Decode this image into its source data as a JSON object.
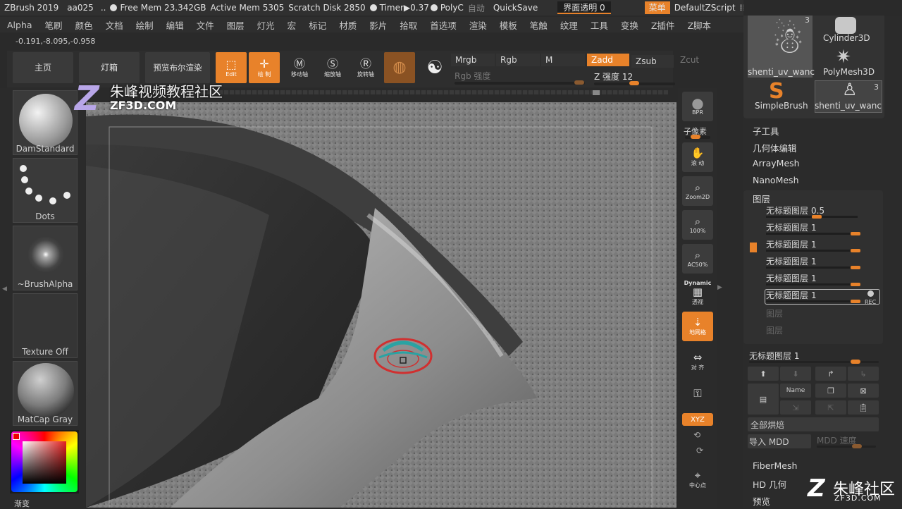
{
  "titlebar": {
    "app": "ZBrush 2019",
    "doc": "aa025",
    "free_mem": "Free Mem 23.342GB",
    "active_mem": "Active Mem 5305",
    "scratch": "Scratch Disk 2850",
    "timer": "Timer▶0.37",
    "polycount": "PolyC",
    "auto": "自动",
    "quicksave": "QuickSave",
    "transparency": "界面透明 0",
    "menu": "菜单",
    "script": "DefaultZScript"
  },
  "menubar": [
    "Alpha",
    "笔刷",
    "颜色",
    "文档",
    "绘制",
    "编辑",
    "文件",
    "图层",
    "灯光",
    "宏",
    "标记",
    "材质",
    "影片",
    "拾取",
    "首选项",
    "渲染",
    "模板",
    "笔触",
    "纹理",
    "工具",
    "变换",
    "Z插件",
    "Z脚本"
  ],
  "coords": "-0.191,-8.095,-0.958",
  "toolbar": {
    "home": "主页",
    "lightbox": "灯箱",
    "bpr_preview": "预览布尔渲染",
    "edit": "Edit",
    "draw": "绘 制",
    "move": "移动轴",
    "scale": "缩放轴",
    "rotate": "旋转轴",
    "mrgb": "Mrgb",
    "rgb": "Rgb",
    "m": "M",
    "zadd": "Zadd",
    "zsub": "Zsub",
    "zcut": "Zcut",
    "rgb_intensity": "Rgb 强度",
    "z_intensity": "Z 强度 12"
  },
  "watermark": {
    "title": "朱峰视频教程社区",
    "url": "ZF3D.COM",
    "brand": "朱峰社区",
    "brand_url": "ZF3D.COM"
  },
  "left_tray": {
    "brush": "DamStandard",
    "stroke": "Dots",
    "alpha": "~BrushAlpha",
    "texture": "Texture Off",
    "material": "MatCap Gray",
    "gradient": "渐变"
  },
  "right_shelf": {
    "bpr": "BPR",
    "subpixel": "子像素",
    "scroll": "滚 动",
    "zoom2d": "Zoom2D",
    "pct100": "100%",
    "ac50": "AC50%",
    "dynamic": "Dynamic",
    "persp": "透视",
    "floor": "地网格",
    "frame": "对 齐",
    "lock": "",
    "xyz": "XYZ",
    "center": "中心点"
  },
  "tools": {
    "t1": "shenti_uv_wanc",
    "t1_count": "3",
    "t2": "Cylinder3D",
    "t3": "PolyMesh3D",
    "t4": "SimpleBrush",
    "t5": "shenti_uv_wanc",
    "t5_count": "3"
  },
  "panel": {
    "subtool": "子工具",
    "geometry": "几何体编辑",
    "arraymesh": "ArrayMesh",
    "nanomesh": "NanoMesh",
    "layers": "图层",
    "layer_items": [
      {
        "name": "无标题图层",
        "value": "0.5",
        "level": 0.5
      },
      {
        "name": "无标题图层",
        "value": "1",
        "level": 1.0
      },
      {
        "name": "无标题图层",
        "value": "1",
        "level": 1.0
      },
      {
        "name": "无标题图层",
        "value": "1",
        "level": 1.0
      },
      {
        "name": "无标题图层",
        "value": "1",
        "level": 1.0
      },
      {
        "name": "无标题图层",
        "value": "1",
        "level": 1.0
      }
    ],
    "rec": "REC",
    "empty_layer": "图层",
    "current_layer": "无标题图层 1",
    "name_btn": "Name",
    "bake_all": "全部烘焙",
    "import_mdd": "导入 MDD",
    "mdd_speed": "MDD 速度",
    "fibermesh": "FiberMesh",
    "hd_geometry": "HD 几何",
    "preview": "预览"
  },
  "colors": {
    "accent": "#e8822a",
    "panel": "#2b2b2b",
    "button": "#3a3a3a"
  }
}
